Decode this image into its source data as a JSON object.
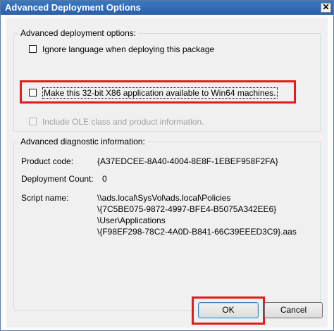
{
  "window": {
    "title": "Advanced Deployment Options",
    "close_glyph": "✕"
  },
  "deployment": {
    "legend": "Advanced deployment options:",
    "ignore_language": {
      "label": "Ignore language when deploying this package",
      "checked": false
    },
    "make_32bit": {
      "label": "Make this 32-bit X86 application available to Win64 machines.",
      "checked": false
    },
    "include_ole": {
      "label": "Include OLE class and product information.",
      "checked": false,
      "disabled": true
    }
  },
  "diagnostic": {
    "legend": "Advanced diagnostic information:",
    "product_code_label": "Product code:",
    "product_code_value": "{A37EDCEE-8A40-4004-8E8F-1EBEF958F2FA}",
    "deployment_count_label": "Deployment Count:",
    "deployment_count_value": "0",
    "script_name_label": "Script name:",
    "script_name_lines": [
      "\\\\ads.local\\SysVol\\ads.local\\Policies",
      "\\{7C5BE075-9872-4997-BFE4-B5075A342EE6}",
      "\\User\\Applications",
      "\\{F98EF298-78C2-4A0D-B841-66C39EEED3C9}.aas"
    ]
  },
  "buttons": {
    "ok_label": "OK",
    "cancel_label": "Cancel"
  },
  "colors": {
    "highlight": "#e21b1b",
    "titlebar": "#2a60a8"
  }
}
